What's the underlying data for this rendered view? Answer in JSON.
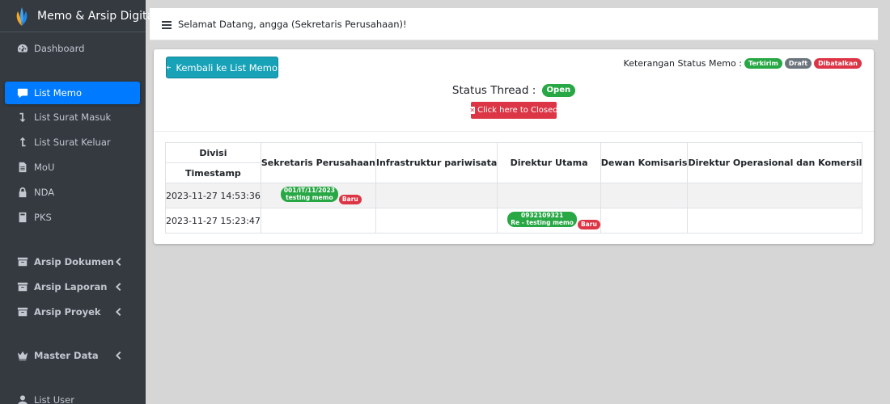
{
  "app": {
    "brand": "Memo & Arsip Digital",
    "accent": "#007bff",
    "sidebar_bg": "#343a40"
  },
  "sidebar": {
    "items": [
      {
        "label": "Dashboard",
        "icon": "tachometer-icon"
      },
      {
        "label": "List Memo",
        "icon": "comment-icon",
        "active": true
      },
      {
        "label": "List Surat Masuk",
        "icon": "arrow-down-icon"
      },
      {
        "label": "List Surat Keluar",
        "icon": "arrow-up-icon"
      },
      {
        "label": "MoU",
        "icon": "file-icon"
      },
      {
        "label": "NDA",
        "icon": "lock-icon"
      },
      {
        "label": "PKS",
        "icon": "book-icon"
      },
      {
        "label": "Arsip Dokumen",
        "icon": "archive-icon",
        "expandable": true
      },
      {
        "label": "Arsip Laporan",
        "icon": "archive-icon",
        "expandable": true
      },
      {
        "label": "Arsip Proyek",
        "icon": "archive-icon",
        "expandable": true
      },
      {
        "label": "Master Data",
        "icon": "crown-icon",
        "expandable": true
      },
      {
        "label": "List User",
        "icon": "user-icon"
      }
    ]
  },
  "header": {
    "welcome": "Selamat Datang, angga (Sekretaris Perusahaan)!"
  },
  "memo": {
    "back_label": "Kembali ke List Memo",
    "legend": {
      "label": "Keterangan Status Memo :",
      "sent": "Terkirim",
      "draft": "Draft",
      "cancelled": "Dibatalkan"
    },
    "thread_label": "Status Thread :",
    "thread_status": "Open",
    "close_label": "Click here to Closed"
  },
  "table": {
    "divisi_label": "Divisi",
    "timestamp_label": "Timestamp",
    "columns": [
      "Sekretaris Perusahaan",
      "Infrastruktur pariwisata",
      "Direktur Utama",
      "Dewan Komisaris",
      "Direktur Operasional dan Komersil"
    ],
    "rows": [
      {
        "timestamp": "2023-11-27 14:53:36",
        "memo_no": "001/IT/11/2023",
        "memo_title": "testing memo",
        "badge": "Baru"
      },
      {
        "timestamp": "2023-11-27 15:23:47",
        "memo_no": "0932109321",
        "memo_title": "Re - testing memo",
        "badge": "Baru"
      }
    ]
  }
}
